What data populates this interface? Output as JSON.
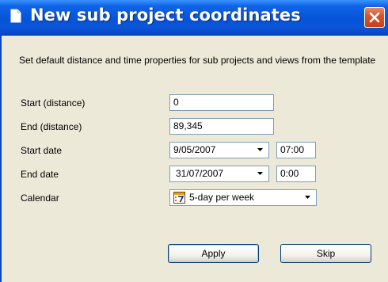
{
  "window": {
    "title": "New sub project coordinates"
  },
  "description": "Set default distance and time properties for sub projects and views from the template",
  "fields": {
    "start_distance": {
      "label": "Start (distance)",
      "value": "0"
    },
    "end_distance": {
      "label": "End (distance)",
      "value": "89,345"
    },
    "start_date": {
      "label": "Start date",
      "date": "9/05/2007",
      "time": "07:00"
    },
    "end_date": {
      "label": "End date",
      "date": "31/07/2007",
      "time": "0:00"
    },
    "calendar": {
      "label": "Calendar",
      "value": "5-day per week",
      "icon": "calendar-icon"
    }
  },
  "buttons": {
    "apply": "Apply",
    "skip": "Skip"
  },
  "colors": {
    "titlebar": "#0754d8",
    "close": "#d8552e",
    "client_bg": "#ece9d8",
    "field_border": "#7f9db9"
  }
}
